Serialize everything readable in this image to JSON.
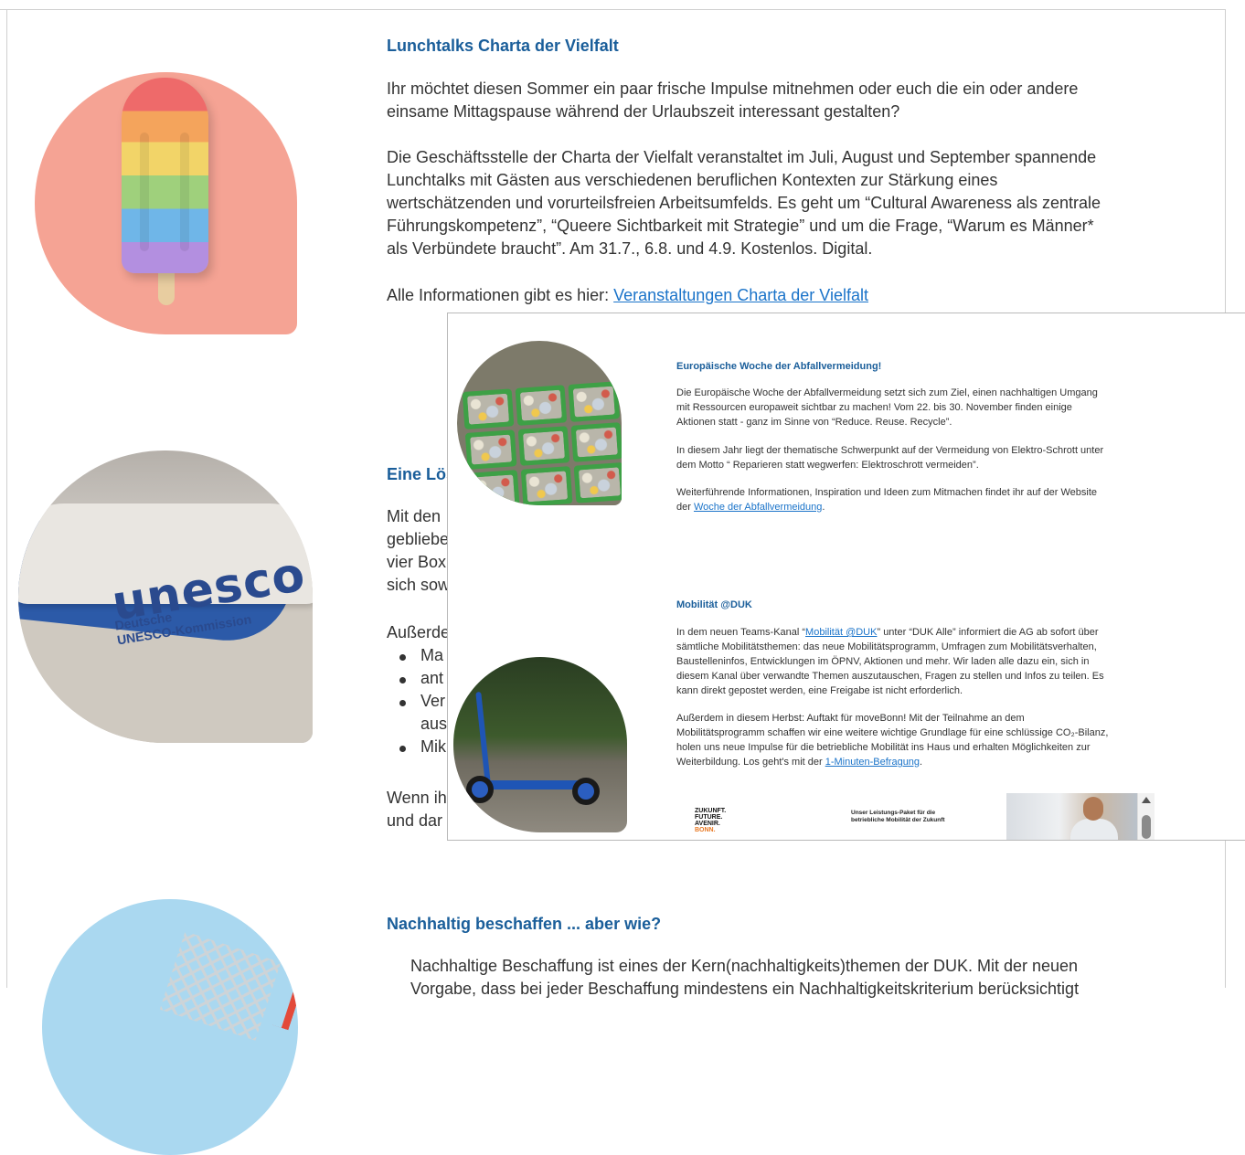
{
  "newsletter": {
    "lunchtalks": {
      "heading": "Lunchtalks Charta der Vielfalt",
      "p1_line1": "Ihr möchtet diesen Sommer ein paar frische Impulse mitnehmen oder euch die ein oder andere",
      "p1_line2": "einsame Mittagspause während der Urlaubszeit interessant gestalten?",
      "p2_line1": "Die Geschäftsstelle der Charta der Vielfalt veranstaltet im Juli, August und September spannende",
      "p2_line2": "Lunchtalks mit Gästen aus verschiedenen beruflichen Kontexten zur Stärkung eines",
      "p2_line3": "wertschätzenden und vorurteilsfreien Arbeitsumfelds. Es geht um “Cultural Awareness als zentrale",
      "p2_line4": "Führungskompetenz”, “Queere Sichtbarkeit mit Strategie” und um die Frage, “Warum es Männer*",
      "p2_line5": "als Verbündete braucht”. Am 31.7., 6.8. und 4.9. Kostenlos. Digital.",
      "info_prefix": "Alle Informationen gibt es hier: ",
      "info_link": "Veranstaltungen Charta der Vielfalt"
    },
    "boxes": {
      "heading": "Eine Lös",
      "lines": [
        "Mit den",
        "gebliebe",
        "vier Box",
        "sich sow"
      ],
      "intro": "Außerde",
      "bullets": [
        "Ma",
        "ant",
        "Ver",
        "Mik"
      ],
      "bullet_cont": "aus",
      "closing_line1": "Wenn ih",
      "closing_line2": "und dar"
    },
    "procurement": {
      "heading": "Nachhaltig beschaffen ... aber wie?",
      "line1": "Nachhaltige Beschaffung ist eines der Kern(nachhaltigkeits)themen der DUK. Mit der neuen",
      "line2": "Vorgabe, dass bei jeder Beschaffung mindestens ein Nachhaltigkeitskriterium berücksichtigt"
    },
    "unesco_logo": {
      "word": "unesco",
      "sub": "Deutsche\nUNESCO-Kommission"
    }
  },
  "overlay": {
    "waste": {
      "heading": "Europäische Woche der Abfallvermeidung!",
      "p1": [
        "Die Europäische Woche der Abfallvermeidung setzt sich zum Ziel, einen nachhaltigen Umgang",
        "mit Ressourcen europaweit sichtbar zu machen! Vom 22. bis 30. November finden einige",
        "Aktionen statt - ganz im Sinne von “Reduce. Reuse. Recycle”."
      ],
      "p2": [
        "In diesem Jahr liegt der thematische Schwerpunkt auf der Vermeidung von Elektro-Schrott unter",
        "dem Motto “ Reparieren statt wegwerfen: Elektroschrott vermeiden”."
      ],
      "p3_line1": "Weiterführende Informationen, Inspiration und Ideen zum Mitmachen findet ihr auf der Website",
      "p3_prefix": "der ",
      "p3_link": "Woche der Abfallvermeidung",
      "p3_suffix": "."
    },
    "mobility": {
      "heading": "Mobilität @DUK",
      "p1_prefix": "In dem neuen Teams-Kanal “",
      "p1_link": "Mobilität @DUK",
      "p1_suffix": "” unter “DUK Alle” informiert die AG ab sofort über",
      "p1_rest": [
        "sämtliche Mobilitätsthemen: das neue Mobilitätsprogramm, Umfragen zum Mobilitätsverhalten,",
        "Baustelleninfos, Entwicklungen im ÖPNV, Aktionen und mehr. Wir laden alle dazu ein, sich in",
        "diesem Kanal über verwandte Themen auszutauschen, Fragen zu stellen und Infos zu teilen. Es",
        "kann direkt gepostet werden, eine Freigabe ist nicht erforderlich."
      ],
      "p2": [
        "Außerdem in diesem Herbst: Auftakt für moveBonn! Mit der Teilnahme an dem",
        "Mobilitätsprogramm schaffen wir eine weitere wichtige Grundlage für eine schlüssige CO₂-Bilanz,",
        "holen uns neue Impulse für die betriebliche Mobilität ins Haus und erhalten Möglichkeiten zur"
      ],
      "p2_last_prefix": "Weiterbildung. Los geht's mit der ",
      "p2_link": "1-Minuten-Befragung",
      "p2_last_suffix": "."
    },
    "footer": {
      "logo_lines": "ZUKUNFT.\nFUTURE.\nAVENIR.",
      "logo_city": "BONN.",
      "tagline": "Unser Leistungs-Paket für die betriebliche Mobilität der Zukunft"
    }
  },
  "colors": {
    "heading": "#1a5e9a",
    "link": "#1a73c9",
    "popsicle_bg": "#f5a394",
    "sky_bg": "#aad8f0"
  },
  "icons": {
    "scroll_up": "scroll-up-arrow-icon"
  }
}
